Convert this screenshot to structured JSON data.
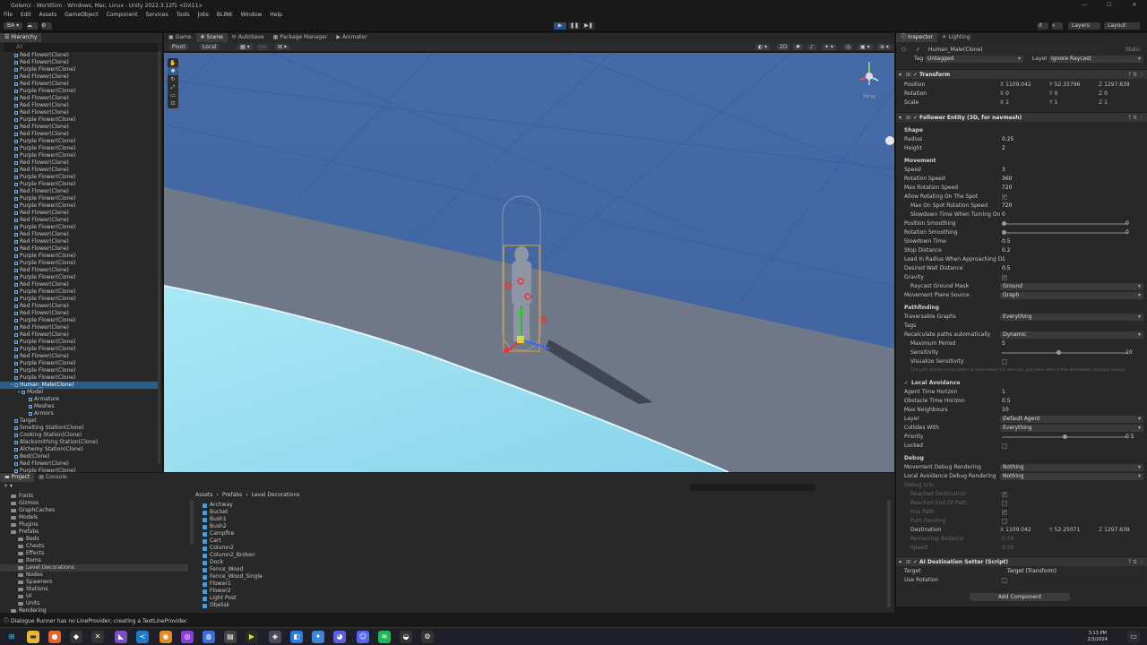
{
  "window": {
    "title": "Golemz - WorldSim - Windows, Mac, Linux - Unity 2022.3.12f1 <DX11>",
    "controls": [
      "—",
      "☐",
      "✕"
    ]
  },
  "menu": [
    "File",
    "Edit",
    "Assets",
    "GameObject",
    "Component",
    "Services",
    "Tools",
    "Jobs",
    "BLINK",
    "Window",
    "Help"
  ],
  "toolbar": {
    "account": "BA ▾",
    "layers": "Layers",
    "layout": "Layout"
  },
  "hierarchy": {
    "tab": "Hierarchy",
    "search": "All",
    "items": [
      {
        "label": "Red Flower(Clone)",
        "depth": 1
      },
      {
        "label": "Red Flower(Clone)",
        "depth": 1
      },
      {
        "label": "Purple Flower(Clone)",
        "depth": 1
      },
      {
        "label": "Red Flower(Clone)",
        "depth": 1
      },
      {
        "label": "Red Flower(Clone)",
        "depth": 1
      },
      {
        "label": "Purple Flower(Clone)",
        "depth": 1
      },
      {
        "label": "Red Flower(Clone)",
        "depth": 1
      },
      {
        "label": "Red Flower(Clone)",
        "depth": 1
      },
      {
        "label": "Red Flower(Clone)",
        "depth": 1
      },
      {
        "label": "Purple Flower(Clone)",
        "depth": 1
      },
      {
        "label": "Red Flower(Clone)",
        "depth": 1
      },
      {
        "label": "Red Flower(Clone)",
        "depth": 1
      },
      {
        "label": "Purple Flower(Clone)",
        "depth": 1
      },
      {
        "label": "Purple Flower(Clone)",
        "depth": 1
      },
      {
        "label": "Purple Flower(Clone)",
        "depth": 1
      },
      {
        "label": "Red Flower(Clone)",
        "depth": 1
      },
      {
        "label": "Red Flower(Clone)",
        "depth": 1
      },
      {
        "label": "Purple Flower(Clone)",
        "depth": 1
      },
      {
        "label": "Purple Flower(Clone)",
        "depth": 1
      },
      {
        "label": "Red Flower(Clone)",
        "depth": 1
      },
      {
        "label": "Purple Flower(Clone)",
        "depth": 1
      },
      {
        "label": "Purple Flower(Clone)",
        "depth": 1
      },
      {
        "label": "Red Flower(Clone)",
        "depth": 1
      },
      {
        "label": "Red Flower(Clone)",
        "depth": 1
      },
      {
        "label": "Purple Flower(Clone)",
        "depth": 1
      },
      {
        "label": "Red Flower(Clone)",
        "depth": 1
      },
      {
        "label": "Red Flower(Clone)",
        "depth": 1
      },
      {
        "label": "Red Flower(Clone)",
        "depth": 1
      },
      {
        "label": "Purple Flower(Clone)",
        "depth": 1
      },
      {
        "label": "Purple Flower(Clone)",
        "depth": 1
      },
      {
        "label": "Red Flower(Clone)",
        "depth": 1
      },
      {
        "label": "Purple Flower(Clone)",
        "depth": 1
      },
      {
        "label": "Red Flower(Clone)",
        "depth": 1
      },
      {
        "label": "Purple Flower(Clone)",
        "depth": 1
      },
      {
        "label": "Purple Flower(Clone)",
        "depth": 1
      },
      {
        "label": "Red Flower(Clone)",
        "depth": 1
      },
      {
        "label": "Red Flower(Clone)",
        "depth": 1
      },
      {
        "label": "Purple Flower(Clone)",
        "depth": 1
      },
      {
        "label": "Red Flower(Clone)",
        "depth": 1
      },
      {
        "label": "Red Flower(Clone)",
        "depth": 1
      },
      {
        "label": "Purple Flower(Clone)",
        "depth": 1
      },
      {
        "label": "Purple Flower(Clone)",
        "depth": 1
      },
      {
        "label": "Red Flower(Clone)",
        "depth": 1
      },
      {
        "label": "Purple Flower(Clone)",
        "depth": 1
      },
      {
        "label": "Purple Flower(Clone)",
        "depth": 1
      },
      {
        "label": "Purple Flower(Clone)",
        "depth": 1
      },
      {
        "label": "Human_Male(Clone)",
        "depth": 1,
        "selected": true,
        "open": true
      },
      {
        "label": "Model",
        "depth": 2,
        "open": true
      },
      {
        "label": "Armature",
        "depth": 3
      },
      {
        "label": "Meshes",
        "depth": 3
      },
      {
        "label": "Armors",
        "depth": 3
      },
      {
        "label": "Target",
        "depth": 1
      },
      {
        "label": "Smelting Station(Clone)",
        "depth": 1
      },
      {
        "label": "Cooking Station(Clone)",
        "depth": 1
      },
      {
        "label": "Blacksmithing Station(Clone)",
        "depth": 1
      },
      {
        "label": "Alchemy Station(Clone)",
        "depth": 1
      },
      {
        "label": "Bed(Clone)",
        "depth": 1
      },
      {
        "label": "Red Flower(Clone)",
        "depth": 1
      },
      {
        "label": "Purple Flower(Clone)",
        "depth": 1
      }
    ]
  },
  "scene": {
    "tabs": [
      "Game",
      "Scene",
      "AutoSave",
      "Package Manager",
      "Animator"
    ],
    "active_tab": "Scene",
    "pivot": "Pivot",
    "local": "Local",
    "persp": "Persp"
  },
  "inspector": {
    "tabs": [
      "Inspector",
      "Lighting"
    ],
    "object_name": "Human_Male(Clone)",
    "static": "Static",
    "tag_label": "Tag",
    "tag": "Untagged",
    "layer_label": "Layer",
    "layer": "Ignore Raycast",
    "transform": {
      "title": "Transform",
      "rows": [
        {
          "label": "Position",
          "x": "1109.042",
          "y": "52.33796",
          "z": "1297.839"
        },
        {
          "label": "Rotation",
          "x": "0",
          "y": "0",
          "z": "0"
        },
        {
          "label": "Scale",
          "x": "1",
          "y": "1",
          "z": "1"
        }
      ]
    },
    "follower": {
      "title": "Follower Entity (3D, for navmesh)",
      "shape": "Shape",
      "radius_l": "Radius",
      "radius": "0.25",
      "height_l": "Height",
      "height": "2",
      "movement": "Movement",
      "speed_l": "Speed",
      "speed": "3",
      "rot_l": "Rotation Speed",
      "rot": "360",
      "maxrot_l": "Max Rotation Speed",
      "maxrot": "720",
      "allow_l": "Allow Rotating On The Spot",
      "maxspot_l": "Max On Spot Rotation Speed",
      "maxspot": "720",
      "slowturn_l": "Slowdown Time When Turning On",
      "slowturn": "0",
      "possmooth_l": "Position Smoothing",
      "possmooth": "0",
      "rotsmooth_l": "Rotation Smoothing",
      "rotsmooth": "0",
      "slowtime_l": "Slowdown Time",
      "slowtime": "0.5",
      "stopdist_l": "Stop Distance",
      "stopdist": "0.2",
      "leadin_l": "Lead In Radius When Approaching D",
      "leadin": "1",
      "wall_l": "Desired Wall Distance",
      "wall": "0.5",
      "gravity_l": "Gravity",
      "raymask_l": "Raycast Ground Mask",
      "raymask": "Ground",
      "plane_l": "Movement Plane Source",
      "plane": "Graph",
      "pathfinding": "Pathfinding",
      "trav_l": "Traversable Graphs",
      "trav": "Everything",
      "tags": "Tags",
      "recalc_l": "Recalculate paths automatically",
      "recalc": "Dynamic",
      "maxper_l": "Maximum Period",
      "maxper": "5",
      "sens_l": "Sensitivity",
      "sens": "10",
      "vis_l": "Visualize Sensitivity",
      "note": "The path will be recalculated at least every 5.0 seconds, but more often if the destination changes quickly",
      "local_av": "Local Avoidance",
      "ath_l": "Agent Time Horizon",
      "ath": "1",
      "oth_l": "Obstacle Time Horizon",
      "oth": "0.5",
      "maxn_l": "Max Neighbours",
      "maxn": "10",
      "layer_l": "Layer",
      "layer": "Default Agent",
      "coll_l": "Collides With",
      "coll": "Everything",
      "prio_l": "Priority",
      "prio": "0.5",
      "locked_l": "Locked",
      "debug": "Debug",
      "mdr_l": "Movement Debug Rendering",
      "mdr": "Nothing",
      "ladr_l": "Local Avoidance Debug Rendering",
      "ladr": "Nothing",
      "dinfo": "Debug Info",
      "rd": "Reached Destination",
      "reop": "Reached End Of Path",
      "hp": "Has Path",
      "pp": "Path Pending",
      "dest_l": "Destination",
      "dx": "1109.042",
      "dy": "52.25071",
      "dz": "1297.639",
      "rem_l": "Remaining distance",
      "rem": "0.00",
      "spd_l": "Speed",
      "spd": "0.00"
    },
    "setter": {
      "title": "AI Destination Setter (Script)",
      "target_l": "Target",
      "target": "Target (Transform)",
      "userot_l": "Use Rotation"
    },
    "add_component": "Add Component"
  },
  "bottom": {
    "tabs": [
      "Project",
      "Console"
    ],
    "breadcrumb": [
      "Assets",
      "Prefabs",
      "Level Decorations"
    ],
    "tree": [
      {
        "label": "Fonts",
        "d": 1
      },
      {
        "label": "Gizmos",
        "d": 1
      },
      {
        "label": "GraphCaches",
        "d": 1
      },
      {
        "label": "Models",
        "d": 1
      },
      {
        "label": "Plugins",
        "d": 1
      },
      {
        "label": "Prefabs",
        "d": 1
      },
      {
        "label": "Beds",
        "d": 2
      },
      {
        "label": "Chests",
        "d": 2
      },
      {
        "label": "Effects",
        "d": 2
      },
      {
        "label": "Items",
        "d": 2
      },
      {
        "label": "Level Decorations",
        "d": 2,
        "sel": true
      },
      {
        "label": "Nodes",
        "d": 2
      },
      {
        "label": "Spawners",
        "d": 2
      },
      {
        "label": "Stations",
        "d": 2
      },
      {
        "label": "UI",
        "d": 2
      },
      {
        "label": "Units",
        "d": 2
      },
      {
        "label": "Rendering",
        "d": 1
      }
    ],
    "assets": [
      "Archway",
      "Bucket",
      "Bush1",
      "Bush2",
      "Campfire",
      "Cart",
      "Column2",
      "Column2_Broken",
      "Dock",
      "Fence_Wood",
      "Fence_Wood_Single",
      "Flower1",
      "Flower2",
      "Light Post",
      "Obelisk"
    ]
  },
  "status": "Dialogue Runner has no LineProvider; creating a TextLineProvider.",
  "taskbar": {
    "time": "3:13 PM",
    "date": "2/3/2024"
  }
}
